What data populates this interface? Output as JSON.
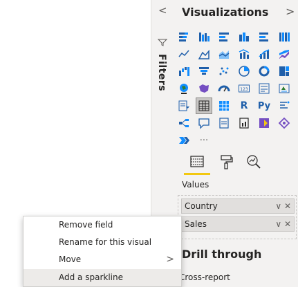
{
  "filters": {
    "label": "Filters",
    "collapse_chevron": "<"
  },
  "visualizations": {
    "title": "Visualizations",
    "next_chevron": ">",
    "more": "···",
    "icons": [
      [
        "stacked-bar-chart",
        "clustered-bar-chart",
        "100-stacked-bar-chart",
        "stacked-column-chart",
        "clustered-column-chart",
        "100-stacked-column-chart"
      ],
      [
        "line-chart",
        "area-chart",
        "stacked-area-chart",
        "line-clustered-column-chart",
        "line-stacked-column-chart",
        "ribbon-chart"
      ],
      [
        "waterfall-chart",
        "funnel-chart",
        "scatter-chart",
        "pie-chart",
        "donut-chart",
        "treemap"
      ],
      [
        "map",
        "filled-map",
        "gauge",
        "card",
        "multi-row-card",
        "kpi"
      ],
      [
        "slicer",
        "table",
        "matrix",
        "r-visual",
        "python-visual",
        "key-influencers"
      ],
      [
        "decomposition-tree",
        "qa-visual",
        "smart-narrative",
        "paginated-report",
        "power-apps",
        "power-automate"
      ],
      [
        "arcgis-map",
        "more-visuals"
      ]
    ],
    "glyphs": {
      "r_visual": "R",
      "python_visual": "Py",
      "card": "123"
    },
    "values_label": "Values",
    "fields": [
      {
        "name": "Country",
        "actions": "∨ ✕"
      },
      {
        "name": "Sales",
        "actions": "∨ ✕"
      }
    ],
    "drill_through_title": "Drill through",
    "cross_report_label": "Cross-report"
  },
  "context_menu": {
    "items": [
      {
        "label": "Remove field",
        "submenu": false
      },
      {
        "label": "Rename for this visual",
        "submenu": false
      },
      {
        "label": "Move",
        "submenu": true,
        "arrow": ">"
      },
      {
        "label": "Add a sparkline",
        "submenu": false
      }
    ]
  },
  "colors": {
    "accent_yellow": "#f2c811",
    "icon_blue": "#1f5faa",
    "icon_teal": "#118dff",
    "icon_purple": "#744ec2"
  }
}
